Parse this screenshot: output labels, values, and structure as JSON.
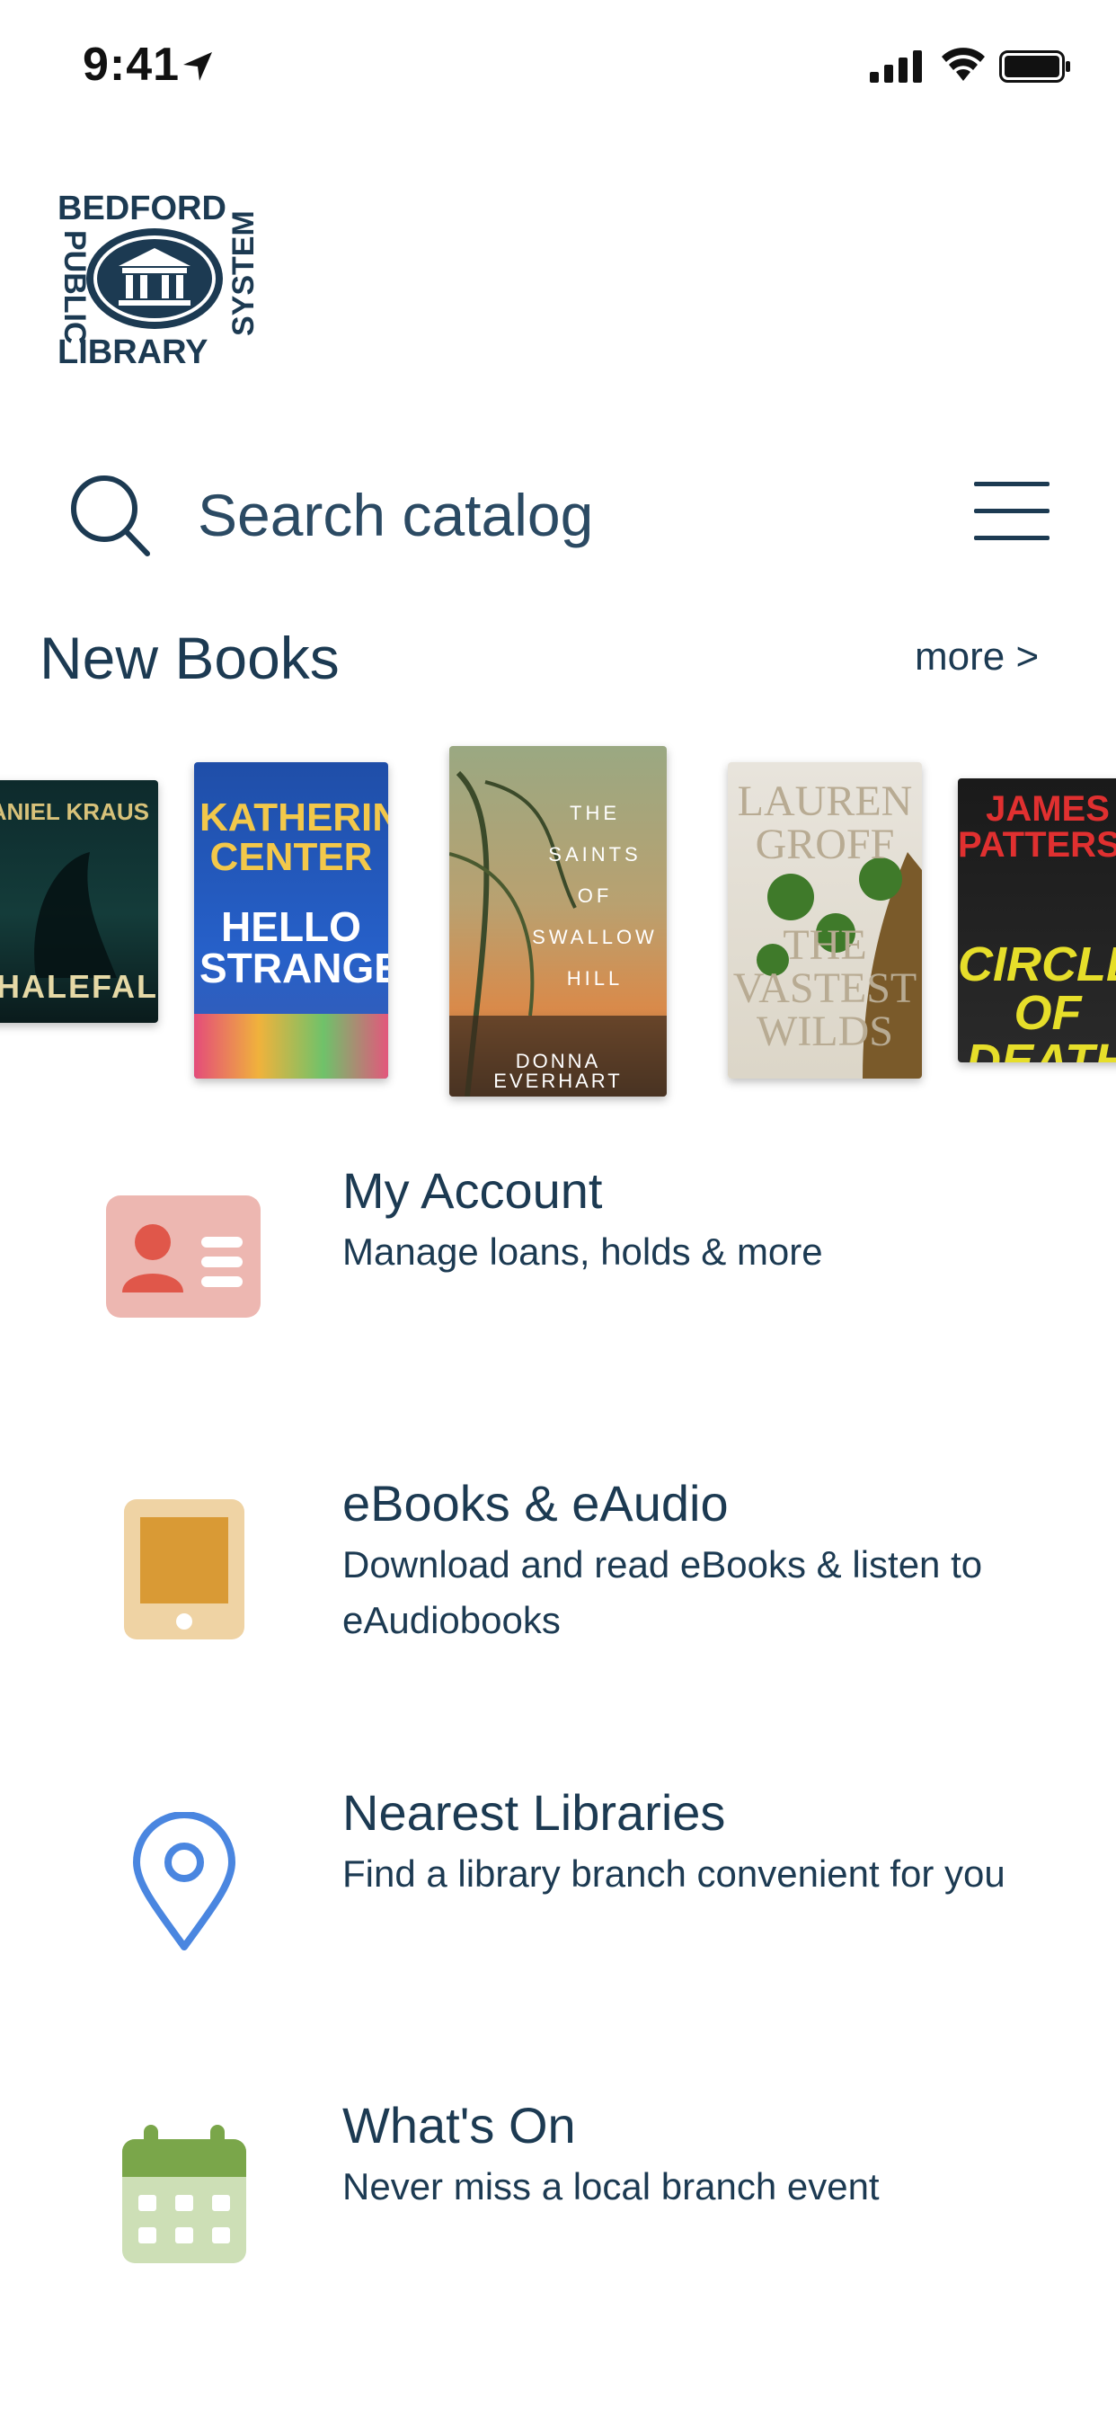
{
  "status_bar": {
    "time": "9:41"
  },
  "logo": {
    "top_text": "BEDFORD",
    "left_text": "PUBLIC",
    "bottom_text": "LIBRARY",
    "right_text": "SYSTEM"
  },
  "search": {
    "placeholder": "Search catalog"
  },
  "new_books": {
    "title": "New Books",
    "more_label": "more >",
    "books": [
      {
        "author": "DANIEL KRAUS",
        "title": "WHALEFALL"
      },
      {
        "author": "KATHERINE CENTER",
        "title": "HELLO STRANGER"
      },
      {
        "author": "DONNA EVERHART",
        "title": "THE SAINTS OF SWALLOW HILL"
      },
      {
        "author": "LAUREN GROFF",
        "title": "THE VASTEST WILDS"
      },
      {
        "author": "JAMES PATTERSON",
        "title": "CIRCLE OF DEATH"
      }
    ]
  },
  "menu": [
    {
      "title": "My Account",
      "description": "Manage loans, holds & more",
      "icon": "account-card-icon"
    },
    {
      "title": "eBooks & eAudio",
      "description": "Download and read eBooks & listen to eAudiobooks",
      "icon": "tablet-icon"
    },
    {
      "title": "Nearest Libraries",
      "description": "Find a library branch convenient for you",
      "icon": "location-pin-icon"
    },
    {
      "title": "What's On",
      "description": "Never miss a local branch event",
      "icon": "calendar-icon"
    }
  ],
  "colors": {
    "primary_text": "#1c3a52",
    "account_icon": "#e0574a",
    "tablet_icon": "#d99a35",
    "pin_icon": "#4a86e0",
    "calendar_icon": "#7aa64a"
  }
}
